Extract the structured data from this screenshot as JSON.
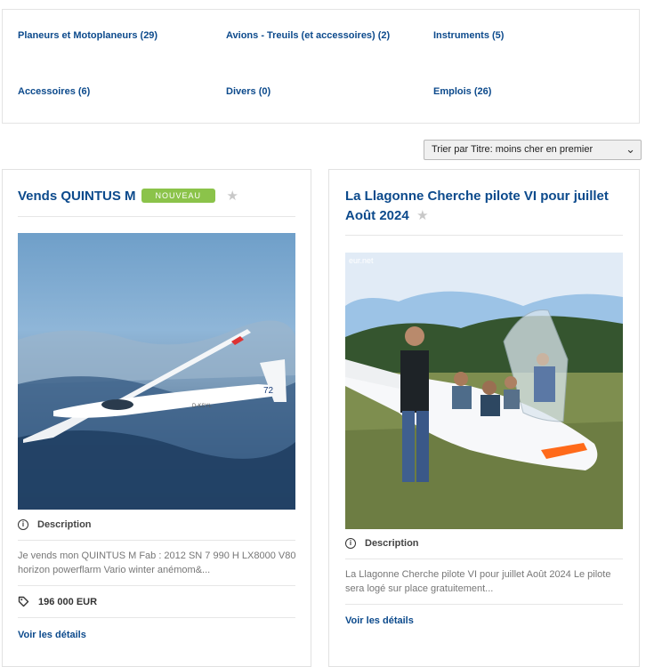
{
  "categories": [
    {
      "label": "Planeurs et Motoplaneurs (29)"
    },
    {
      "label": "Avions - Treuils (et accessoires) (2)"
    },
    {
      "label": "Instruments (5)"
    },
    {
      "label": "Accessoires (6)"
    },
    {
      "label": "Divers (0)"
    },
    {
      "label": "Emplois (26)"
    }
  ],
  "sort": {
    "selected": "Trier par Titre: moins cher en premier"
  },
  "listings": [
    {
      "title": "Vends QUINTUS M",
      "badge": "NOUVEAU",
      "description_label": "Description",
      "description": "Je vends mon QUINTUS M Fab : 2012  SN 7 990 H LX8000 V80 horizon  powerflarm Vario winter anémom&...",
      "price": "196 000 EUR",
      "details_link": "Voir les détails",
      "photo_tail_number": "72",
      "photo_registration": "D-KSYL"
    },
    {
      "title": "La Llagonne Cherche pilote VI pour juillet Août 2024",
      "description_label": "Description",
      "description": "La Llagonne Cherche pilote VI pour juillet Août 2024 Le pilote sera logé sur place gratuitement...",
      "details_link": "Voir les détails",
      "photo_watermark": "eur.net"
    }
  ],
  "colors": {
    "link": "#0c4a8c",
    "badge": "#8bc34a"
  }
}
